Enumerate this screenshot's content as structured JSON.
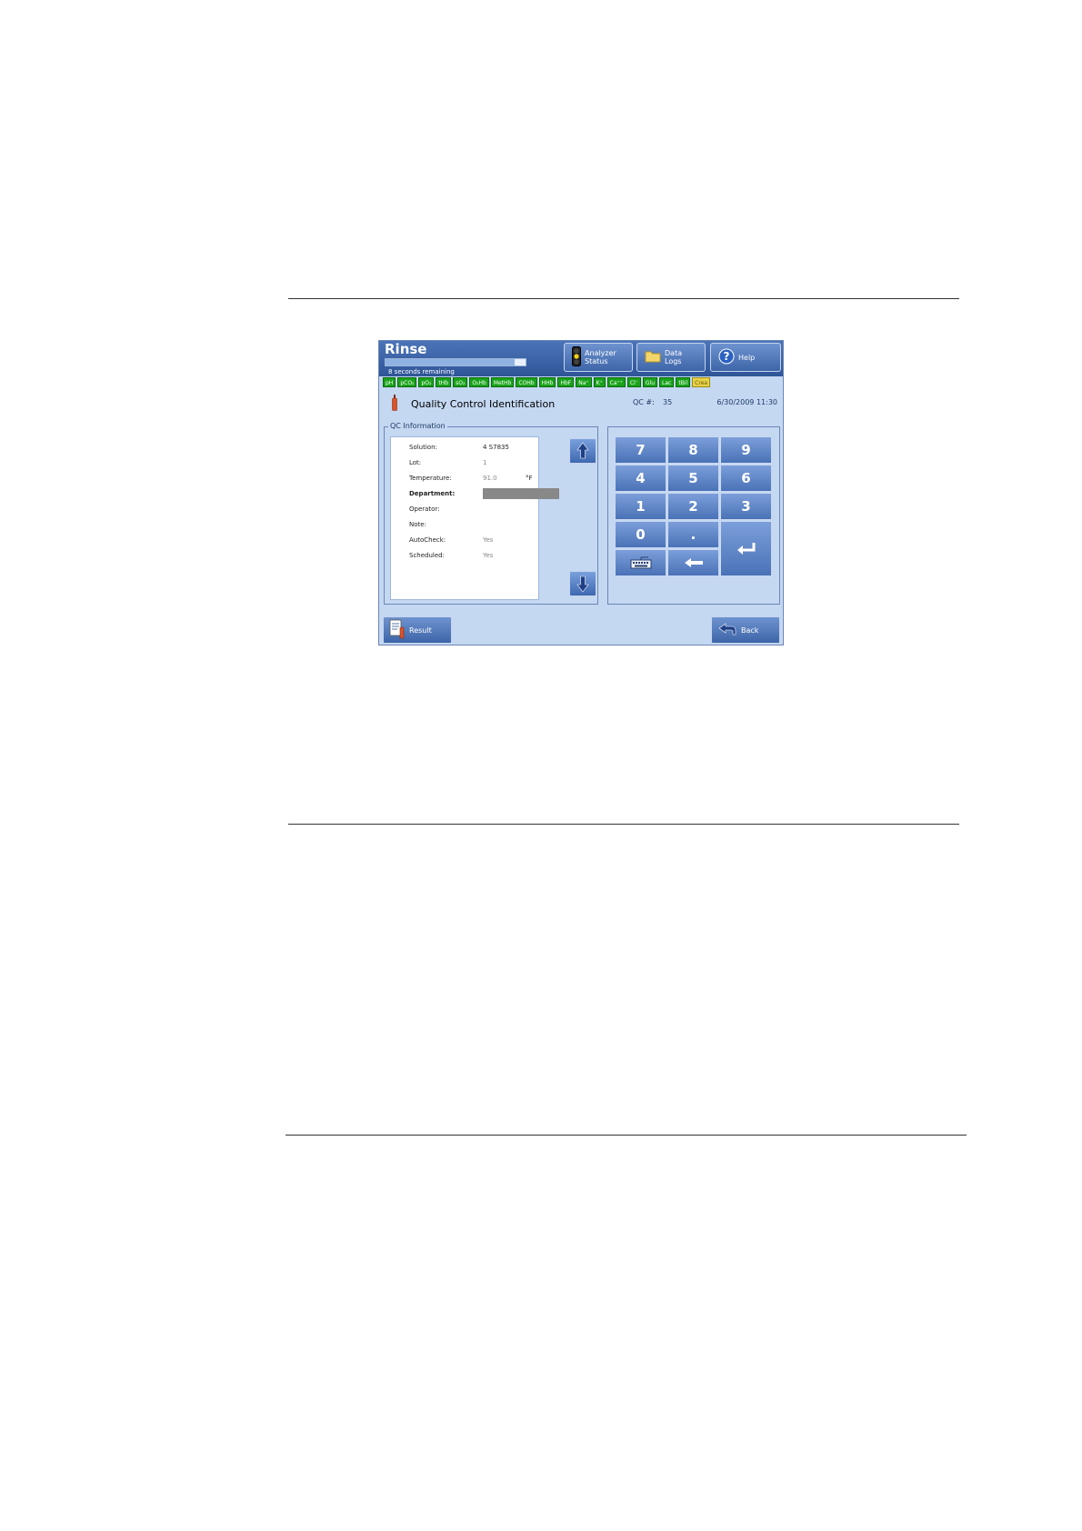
{
  "window": {
    "title": "Rinse",
    "progress_text": "8 seconds remaining",
    "progress_fraction": 0.92
  },
  "toolbar": {
    "analyzer_status": "Analyzer\nStatus",
    "data_logs": "Data\nLogs",
    "help": "Help"
  },
  "analytes": [
    {
      "label": "pH",
      "status": "ok"
    },
    {
      "label": "pCO₂",
      "status": "ok"
    },
    {
      "label": "pO₂",
      "status": "ok"
    },
    {
      "label": "tHb",
      "status": "ok"
    },
    {
      "label": "sO₂",
      "status": "ok"
    },
    {
      "label": "O₂Hb",
      "status": "ok"
    },
    {
      "label": "MetHb",
      "status": "ok"
    },
    {
      "label": "COHb",
      "status": "ok"
    },
    {
      "label": "HHb",
      "status": "ok"
    },
    {
      "label": "HbF",
      "status": "ok"
    },
    {
      "label": "Na⁺",
      "status": "ok"
    },
    {
      "label": "K⁺",
      "status": "ok"
    },
    {
      "label": "Ca⁺⁺",
      "status": "ok"
    },
    {
      "label": "Cl⁻",
      "status": "ok"
    },
    {
      "label": "Glu",
      "status": "ok"
    },
    {
      "label": "Lac",
      "status": "ok"
    },
    {
      "label": "tBil",
      "status": "ok"
    },
    {
      "label": "Crea",
      "status": "warning"
    }
  ],
  "header": {
    "title": "Quality Control Identification",
    "qc_label": "QC #:",
    "qc_number": "35",
    "datetime": "6/30/2009 11:30"
  },
  "qc_info": {
    "legend": "QC Information",
    "solution_label": "Solution:",
    "solution_value": "4  S7835",
    "lot_label": "Lot:",
    "lot_value": "1",
    "temperature_label": "Temperature:",
    "temperature_value": "91.0",
    "temperature_unit": "°F",
    "department_label": "Department:",
    "department_value": "",
    "operator_label": "Operator:",
    "note_label": "Note:",
    "autocheck_label": "AutoCheck:",
    "autocheck_value": "Yes",
    "scheduled_label": "Scheduled:",
    "scheduled_value": "Yes"
  },
  "keypad": {
    "k7": "7",
    "k8": "8",
    "k9": "9",
    "k4": "4",
    "k5": "5",
    "k6": "6",
    "k1": "1",
    "k2": "2",
    "k3": "3",
    "k0": "0",
    "kdot": "."
  },
  "footer": {
    "result_label": "Result",
    "back_label": "Back"
  },
  "colors": {
    "screen_bg": "#c4d8f2",
    "titlebar": "#2f5597",
    "button": "#4a72b7",
    "analyte_ok": "#19a31a",
    "analyte_warning": "#e6d24a"
  }
}
